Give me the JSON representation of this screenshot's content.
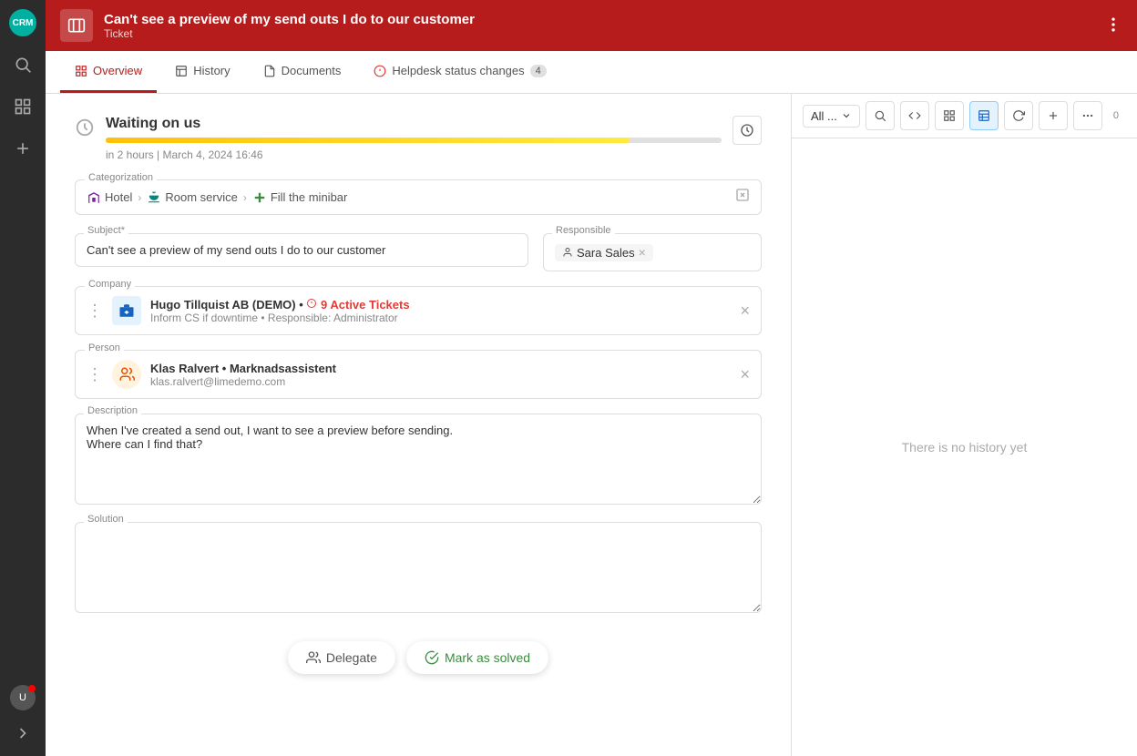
{
  "app": {
    "logo": "crm"
  },
  "header": {
    "title": "Can't see a preview of my send outs I do to our customer",
    "subtitle": "Ticket",
    "more_icon": "more-vertical"
  },
  "tabs": [
    {
      "id": "overview",
      "label": "Overview",
      "active": true,
      "badge": null
    },
    {
      "id": "history",
      "label": "History",
      "active": false,
      "badge": null
    },
    {
      "id": "documents",
      "label": "Documents",
      "active": false,
      "badge": null
    },
    {
      "id": "helpdesk",
      "label": "Helpdesk status changes",
      "active": false,
      "badge": "4"
    }
  ],
  "status": {
    "label": "Waiting on us",
    "time_text": "in 2 hours | March 4, 2024 16:46",
    "progress": 85
  },
  "categorization": {
    "field_label": "Categorization",
    "items": [
      {
        "id": "hotel",
        "label": "Hotel",
        "icon_type": "hotel"
      },
      {
        "id": "room_service",
        "label": "Room service",
        "icon_type": "room_service"
      },
      {
        "id": "fill_minibar",
        "label": "Fill the minibar",
        "icon_type": "plus"
      }
    ]
  },
  "subject": {
    "label": "Subject*",
    "value": "Can't see a preview of my send outs I do to our customer",
    "placeholder": "Subject"
  },
  "responsible": {
    "label": "Responsible",
    "value": "Sara Sales"
  },
  "company": {
    "label": "Company",
    "name": "Hugo Tillquist AB (DEMO)",
    "active_tickets": "9 Active Tickets",
    "subtitle": "Inform CS if downtime • Responsible: Administrator"
  },
  "person": {
    "label": "Person",
    "name": "Klas Ralvert",
    "role": "Marknadsassistent",
    "email": "klas.ralvert@limedemo.com"
  },
  "description": {
    "label": "Description",
    "value": "When I've created a send out, I want to see a preview before sending.\nWhere can I find that?"
  },
  "solution": {
    "label": "Solution",
    "value": ""
  },
  "actions": {
    "delegate_label": "Delegate",
    "mark_solved_label": "Mark as solved"
  },
  "right_panel": {
    "filter_label": "All ...",
    "count": "0",
    "empty_message": "There is no history yet"
  },
  "sidebar": {
    "icons": [
      {
        "id": "search",
        "label": "search-icon"
      },
      {
        "id": "grid",
        "label": "grid-icon"
      },
      {
        "id": "add",
        "label": "add-icon"
      }
    ]
  }
}
